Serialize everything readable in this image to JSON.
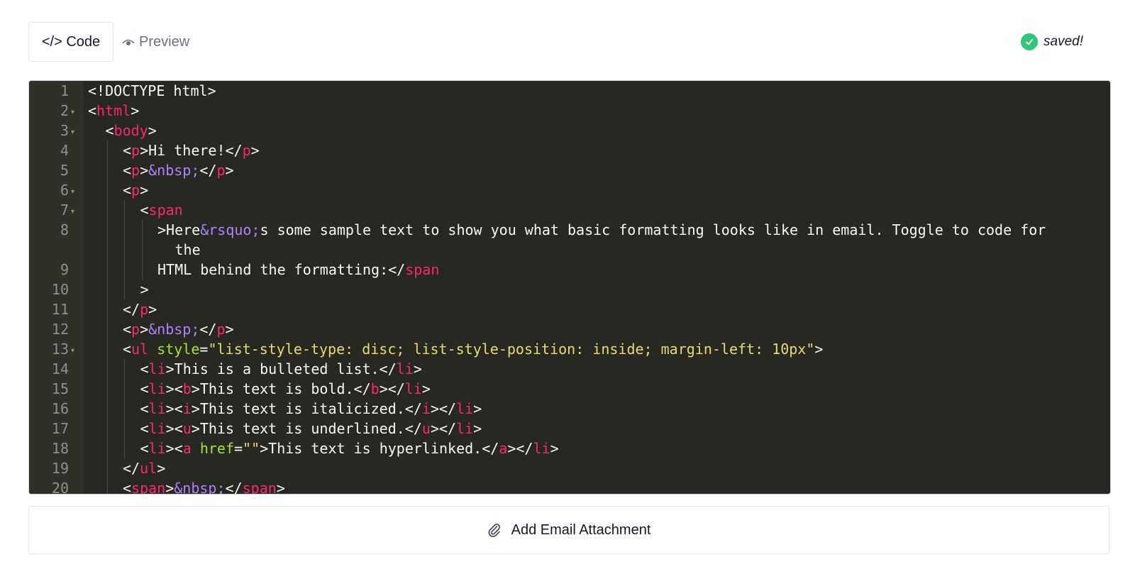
{
  "tabs": {
    "code_label": "</> Code",
    "preview_label": "Preview"
  },
  "status": {
    "saved_text": "saved!"
  },
  "colors": {
    "editor_bg": "#272822",
    "tag": "#f92672",
    "attr": "#a6e22e",
    "string": "#e6db74",
    "entity": "#ae81ff",
    "saved_green": "#34c77b"
  },
  "editor": {
    "lines": [
      {
        "num": "1",
        "fold": false,
        "indent": 0,
        "tokens": [
          {
            "t": "<!DOCTYPE html>",
            "c": ""
          }
        ]
      },
      {
        "num": "2",
        "fold": true,
        "indent": 0,
        "tokens": [
          {
            "t": "<",
            "c": ""
          },
          {
            "t": "html",
            "c": "t"
          },
          {
            "t": ">",
            "c": ""
          }
        ]
      },
      {
        "num": "3",
        "fold": true,
        "indent": 1,
        "tokens": [
          {
            "t": "<",
            "c": ""
          },
          {
            "t": "body",
            "c": "t"
          },
          {
            "t": ">",
            "c": ""
          }
        ]
      },
      {
        "num": "4",
        "fold": false,
        "indent": 2,
        "tokens": [
          {
            "t": "<",
            "c": ""
          },
          {
            "t": "p",
            "c": "t"
          },
          {
            "t": ">Hi there!</",
            "c": ""
          },
          {
            "t": "p",
            "c": "t"
          },
          {
            "t": ">",
            "c": ""
          }
        ]
      },
      {
        "num": "5",
        "fold": false,
        "indent": 2,
        "tokens": [
          {
            "t": "<",
            "c": ""
          },
          {
            "t": "p",
            "c": "t"
          },
          {
            "t": ">",
            "c": ""
          },
          {
            "t": "&nbsp;",
            "c": "e"
          },
          {
            "t": "</",
            "c": ""
          },
          {
            "t": "p",
            "c": "t"
          },
          {
            "t": ">",
            "c": ""
          }
        ]
      },
      {
        "num": "6",
        "fold": true,
        "indent": 2,
        "tokens": [
          {
            "t": "<",
            "c": ""
          },
          {
            "t": "p",
            "c": "t"
          },
          {
            "t": ">",
            "c": ""
          }
        ]
      },
      {
        "num": "7",
        "fold": true,
        "indent": 3,
        "tokens": [
          {
            "t": "<",
            "c": ""
          },
          {
            "t": "span",
            "c": "t"
          }
        ]
      },
      {
        "num": "8",
        "fold": false,
        "indent": 4,
        "tokens": [
          {
            "t": ">Here",
            "c": ""
          },
          {
            "t": "&rsquo;",
            "c": "e"
          },
          {
            "t": "s some sample text to show you what basic formatting looks like in email. Toggle to code for",
            "c": ""
          }
        ]
      },
      {
        "num": "",
        "fold": false,
        "indent": 5,
        "tokens": [
          {
            "t": "the",
            "c": ""
          }
        ]
      },
      {
        "num": "9",
        "fold": false,
        "indent": 4,
        "tokens": [
          {
            "t": "HTML behind the formatting:</",
            "c": ""
          },
          {
            "t": "span",
            "c": "t"
          }
        ]
      },
      {
        "num": "10",
        "fold": false,
        "indent": 3,
        "tokens": [
          {
            "t": ">",
            "c": ""
          }
        ]
      },
      {
        "num": "11",
        "fold": false,
        "indent": 2,
        "tokens": [
          {
            "t": "</",
            "c": ""
          },
          {
            "t": "p",
            "c": "t"
          },
          {
            "t": ">",
            "c": ""
          }
        ]
      },
      {
        "num": "12",
        "fold": false,
        "indent": 2,
        "tokens": [
          {
            "t": "<",
            "c": ""
          },
          {
            "t": "p",
            "c": "t"
          },
          {
            "t": ">",
            "c": ""
          },
          {
            "t": "&nbsp;",
            "c": "e"
          },
          {
            "t": "</",
            "c": ""
          },
          {
            "t": "p",
            "c": "t"
          },
          {
            "t": ">",
            "c": ""
          }
        ]
      },
      {
        "num": "13",
        "fold": true,
        "indent": 2,
        "tokens": [
          {
            "t": "<",
            "c": ""
          },
          {
            "t": "ul",
            "c": "t"
          },
          {
            "t": " ",
            "c": ""
          },
          {
            "t": "style",
            "c": "a"
          },
          {
            "t": "=",
            "c": ""
          },
          {
            "t": "\"list-style-type: disc; list-style-position: inside; margin-left: 10px\"",
            "c": "s"
          },
          {
            "t": ">",
            "c": ""
          }
        ]
      },
      {
        "num": "14",
        "fold": false,
        "indent": 3,
        "tokens": [
          {
            "t": "<",
            "c": ""
          },
          {
            "t": "li",
            "c": "t"
          },
          {
            "t": ">This is a bulleted list.</",
            "c": ""
          },
          {
            "t": "li",
            "c": "t"
          },
          {
            "t": ">",
            "c": ""
          }
        ]
      },
      {
        "num": "15",
        "fold": false,
        "indent": 3,
        "tokens": [
          {
            "t": "<",
            "c": ""
          },
          {
            "t": "li",
            "c": "t"
          },
          {
            "t": "><",
            "c": ""
          },
          {
            "t": "b",
            "c": "t"
          },
          {
            "t": ">This text is bold.</",
            "c": ""
          },
          {
            "t": "b",
            "c": "t"
          },
          {
            "t": "></",
            "c": ""
          },
          {
            "t": "li",
            "c": "t"
          },
          {
            "t": ">",
            "c": ""
          }
        ]
      },
      {
        "num": "16",
        "fold": false,
        "indent": 3,
        "tokens": [
          {
            "t": "<",
            "c": ""
          },
          {
            "t": "li",
            "c": "t"
          },
          {
            "t": "><",
            "c": ""
          },
          {
            "t": "i",
            "c": "t"
          },
          {
            "t": ">This text is italicized.</",
            "c": ""
          },
          {
            "t": "i",
            "c": "t"
          },
          {
            "t": "></",
            "c": ""
          },
          {
            "t": "li",
            "c": "t"
          },
          {
            "t": ">",
            "c": ""
          }
        ]
      },
      {
        "num": "17",
        "fold": false,
        "indent": 3,
        "tokens": [
          {
            "t": "<",
            "c": ""
          },
          {
            "t": "li",
            "c": "t"
          },
          {
            "t": "><",
            "c": ""
          },
          {
            "t": "u",
            "c": "t"
          },
          {
            "t": ">This text is underlined.</",
            "c": ""
          },
          {
            "t": "u",
            "c": "t"
          },
          {
            "t": "></",
            "c": ""
          },
          {
            "t": "li",
            "c": "t"
          },
          {
            "t": ">",
            "c": ""
          }
        ]
      },
      {
        "num": "18",
        "fold": false,
        "indent": 3,
        "tokens": [
          {
            "t": "<",
            "c": ""
          },
          {
            "t": "li",
            "c": "t"
          },
          {
            "t": "><",
            "c": ""
          },
          {
            "t": "a",
            "c": "t"
          },
          {
            "t": " ",
            "c": ""
          },
          {
            "t": "href",
            "c": "a"
          },
          {
            "t": "=",
            "c": ""
          },
          {
            "t": "\"\"",
            "c": "s"
          },
          {
            "t": ">This text is hyperlinked.</",
            "c": ""
          },
          {
            "t": "a",
            "c": "t"
          },
          {
            "t": "></",
            "c": ""
          },
          {
            "t": "li",
            "c": "t"
          },
          {
            "t": ">",
            "c": ""
          }
        ]
      },
      {
        "num": "19",
        "fold": false,
        "indent": 2,
        "tokens": [
          {
            "t": "</",
            "c": ""
          },
          {
            "t": "ul",
            "c": "t"
          },
          {
            "t": ">",
            "c": ""
          }
        ]
      },
      {
        "num": "20",
        "fold": false,
        "indent": 2,
        "tokens": [
          {
            "t": "<",
            "c": ""
          },
          {
            "t": "span",
            "c": "t"
          },
          {
            "t": ">",
            "c": ""
          },
          {
            "t": "&nbsp;",
            "c": "e"
          },
          {
            "t": "</",
            "c": ""
          },
          {
            "t": "span",
            "c": "t"
          },
          {
            "t": ">",
            "c": ""
          }
        ]
      }
    ]
  },
  "attachment": {
    "label": "Add Email Attachment"
  }
}
